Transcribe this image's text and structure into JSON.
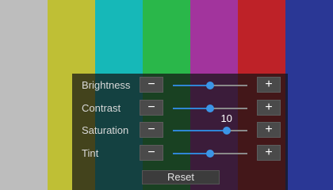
{
  "test_pattern": {
    "colors": [
      "#bdbdbd",
      "#bfbf35",
      "#16b8b8",
      "#2ab74a",
      "#a2349d",
      "#be2228",
      "#2a3795"
    ]
  },
  "picture_settings": {
    "accent_color": "#2f86d6",
    "sliders": [
      {
        "label": "Brightness",
        "level": 0.5,
        "minus_icon": "minus-icon",
        "plus_icon": "plus-icon"
      },
      {
        "label": "Contrast",
        "level": 0.5,
        "minus_icon": "minus-icon",
        "plus_icon": "plus-icon"
      },
      {
        "label": "Saturation",
        "level": 0.72,
        "value_tooltip": "10",
        "minus_icon": "minus-icon",
        "plus_icon": "plus-icon"
      },
      {
        "label": "Tint",
        "level": 0.5,
        "minus_icon": "minus-icon",
        "plus_icon": "plus-icon"
      }
    ],
    "reset_label": "Reset"
  }
}
